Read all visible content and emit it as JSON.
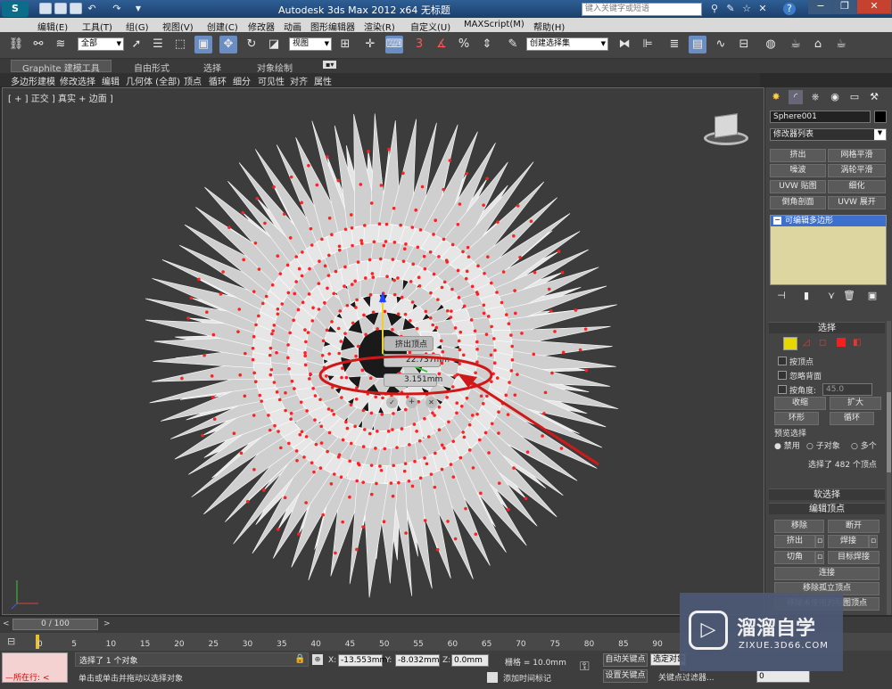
{
  "titlebar": {
    "app_title": "Autodesk 3ds Max  2012 x64      无标题",
    "search_placeholder": "键入关键字或短语"
  },
  "menu": [
    "编辑(E)",
    "工具(T)",
    "组(G)",
    "视图(V)",
    "创建(C)",
    "修改器",
    "动画",
    "图形编辑器",
    "渲染(R)",
    "自定义(U)",
    "MAXScript(M)",
    "帮助(H)"
  ],
  "toolbar": {
    "selection_filter": "全部",
    "ref_coord": "视图",
    "named_selection": "创建选择集",
    "angle_snap": "3",
    "percent_snap": "%"
  },
  "ribbon": {
    "tabs": [
      "Graphite 建模工具",
      "自由形式",
      "选择",
      "对象绘制"
    ]
  },
  "subribbon": [
    "多边形建模",
    "修改选择",
    "编辑",
    "几何体 (全部)",
    "顶点",
    "循环",
    "细分",
    "可见性",
    "对齐",
    "属性"
  ],
  "viewport": {
    "label": "[ + ] 正交 ] 真实 + 边面 ]",
    "caddy_title": "挤出顶点",
    "height_value": "22.737mm",
    "width_value": "3.151mm"
  },
  "command_panel": {
    "object_name": "Sphere001",
    "modifier_list": "修改器列表",
    "modifier_buttons": [
      "挤出",
      "网格平滑",
      "噪波",
      "涡轮平滑",
      "UVW 贴图",
      "细化",
      "倒角剖面",
      "UVW 展开"
    ],
    "stack_item": "可编辑多边形",
    "selection_header": "选择",
    "by_vertex": "按顶点",
    "ignore_backface": "忽略背面",
    "by_angle": "按角度:",
    "angle_value": "45.0",
    "shrink": "收缩",
    "grow": "扩大",
    "ring": "环形",
    "loop": "循环",
    "preview_label": "预览选择",
    "preview_disabled": "禁用",
    "preview_subobj": "子对象",
    "preview_multi": "多个",
    "sel_info": "选择了 482 个顶点",
    "soft_sel_header": "软选择",
    "edit_vertices_header": "编辑顶点",
    "remove": "移除",
    "break": "断开",
    "extrude": "挤出",
    "weld": "焊接",
    "chamfer": "切角",
    "target_weld": "目标焊接",
    "connect": "连接",
    "remove_isolated": "移除孤立顶点",
    "remove_unused": "移除未使用的贴图顶点"
  },
  "timeline": {
    "frame_display": "0 / 100",
    "ticks": [
      "0",
      "5",
      "10",
      "15",
      "20",
      "25",
      "30",
      "35",
      "40",
      "45",
      "50",
      "55",
      "60",
      "65",
      "70",
      "75",
      "80",
      "85",
      "90"
    ]
  },
  "status": {
    "maxscript_label": "所在行:",
    "selected_text": "选择了 1 个对象",
    "prompt_text": "单击或单击并拖动以选择对象",
    "x_label": "X:",
    "x_value": "-13.553mm",
    "y_label": "Y:",
    "y_value": "-8.032mm",
    "z_label": "Z:",
    "z_value": "0.0mm",
    "grid": "栅格 = 10.0mm",
    "add_time_tag": "添加时间标记",
    "auto_key": "自动关键点",
    "set_key": "设置关键点",
    "selected_dropdown": "选定对象",
    "key_filters": "关键点过滤器...",
    "frame_value": "0"
  },
  "watermark": {
    "brand": "溜溜自学",
    "url": "ZIXUE.3D66.COM"
  },
  "colors": {
    "vertex": "#ff2020",
    "annotation": "#d01818",
    "title_blue": "#1c3f6b"
  }
}
